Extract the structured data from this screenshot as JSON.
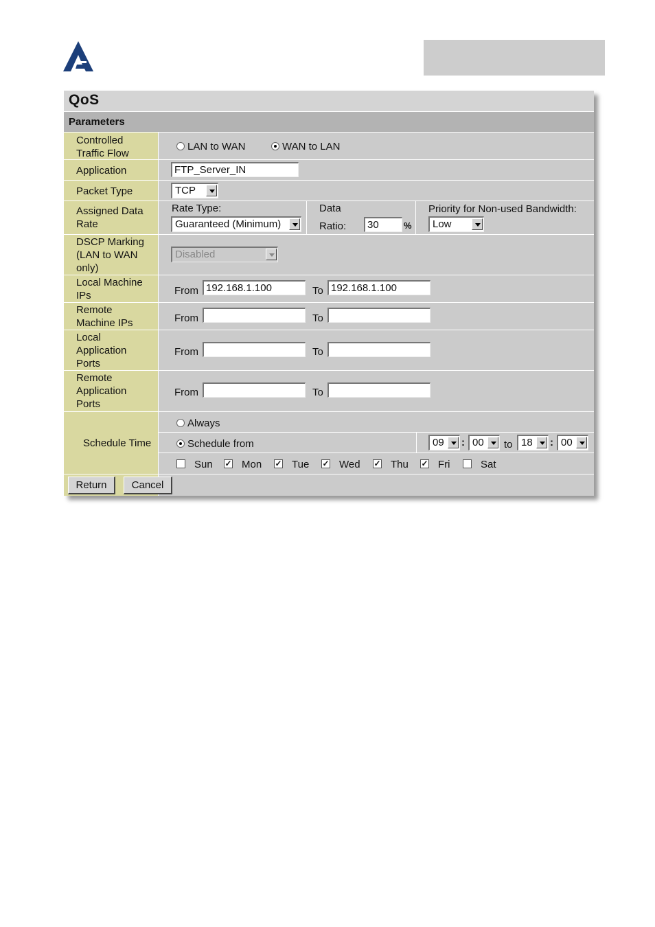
{
  "header": {
    "title": "QoS",
    "section": "Parameters"
  },
  "flow": {
    "label_line1": "Controlled",
    "label_line2": "Traffic Flow",
    "option_lan_to_wan": "LAN to WAN",
    "option_wan_to_lan": "WAN to LAN",
    "selected": "WAN to LAN"
  },
  "application": {
    "label": "Application",
    "value": "FTP_Server_IN"
  },
  "packet_type": {
    "label": "Packet Type",
    "value": "TCP"
  },
  "rate": {
    "label_line1": "Assigned Data",
    "label_line2": "Rate",
    "rate_type_label": "Rate Type:",
    "rate_type_value": "Guaranteed (Minimum)",
    "data_label": "Data",
    "ratio_label": "Ratio:",
    "ratio_value": "30",
    "percent": "%",
    "priority_label": "Priority for Non-used Bandwidth:",
    "priority_value": "Low"
  },
  "dscp": {
    "label_line1": "DSCP Marking",
    "label_line2": "(LAN to WAN",
    "label_line3": "only)",
    "value": "Disabled"
  },
  "local_ips": {
    "label_line1": "Local Machine",
    "label_line2": "IPs",
    "from_label": "From",
    "from_value": "192.168.1.100",
    "to_label": "To",
    "to_value": "192.168.1.100"
  },
  "remote_ips": {
    "label_line1": "Remote",
    "label_line2": "Machine IPs",
    "from_label": "From",
    "from_value": "",
    "to_label": "To",
    "to_value": ""
  },
  "local_ports": {
    "label_line1": "Local",
    "label_line2": "Application",
    "label_line3": "Ports",
    "from_label": "From",
    "from_value": "",
    "to_label": "To",
    "to_value": ""
  },
  "remote_ports": {
    "label_line1": "Remote",
    "label_line2": "Application",
    "label_line3": "Ports",
    "from_label": "From",
    "from_value": "",
    "to_label": "To",
    "to_value": ""
  },
  "schedule": {
    "label": "Schedule Time",
    "option_always": "Always",
    "option_schedule": "Schedule from",
    "selected": "Schedule from",
    "start_hour": "09",
    "start_min": "00",
    "to_label": "to",
    "end_hour": "18",
    "end_min": "00",
    "colon": ":",
    "days": [
      {
        "name": "Sun",
        "checked": false
      },
      {
        "name": "Mon",
        "checked": true
      },
      {
        "name": "Tue",
        "checked": true
      },
      {
        "name": "Wed",
        "checked": true
      },
      {
        "name": "Thu",
        "checked": true
      },
      {
        "name": "Fri",
        "checked": true
      },
      {
        "name": "Sat",
        "checked": false
      }
    ]
  },
  "buttons": {
    "return_label": "Return",
    "cancel_label": "Cancel"
  },
  "colors": {
    "label_bg": "#d9d8a0",
    "panel_bg": "#cbcbcb",
    "section_bg": "#b3b3b3",
    "logo": "#1c3f7a",
    "top_box": "#cdcdcd"
  },
  "icons": {
    "logo": "atlantis-logo-icon",
    "dropdown": "chevron-down-icon"
  }
}
